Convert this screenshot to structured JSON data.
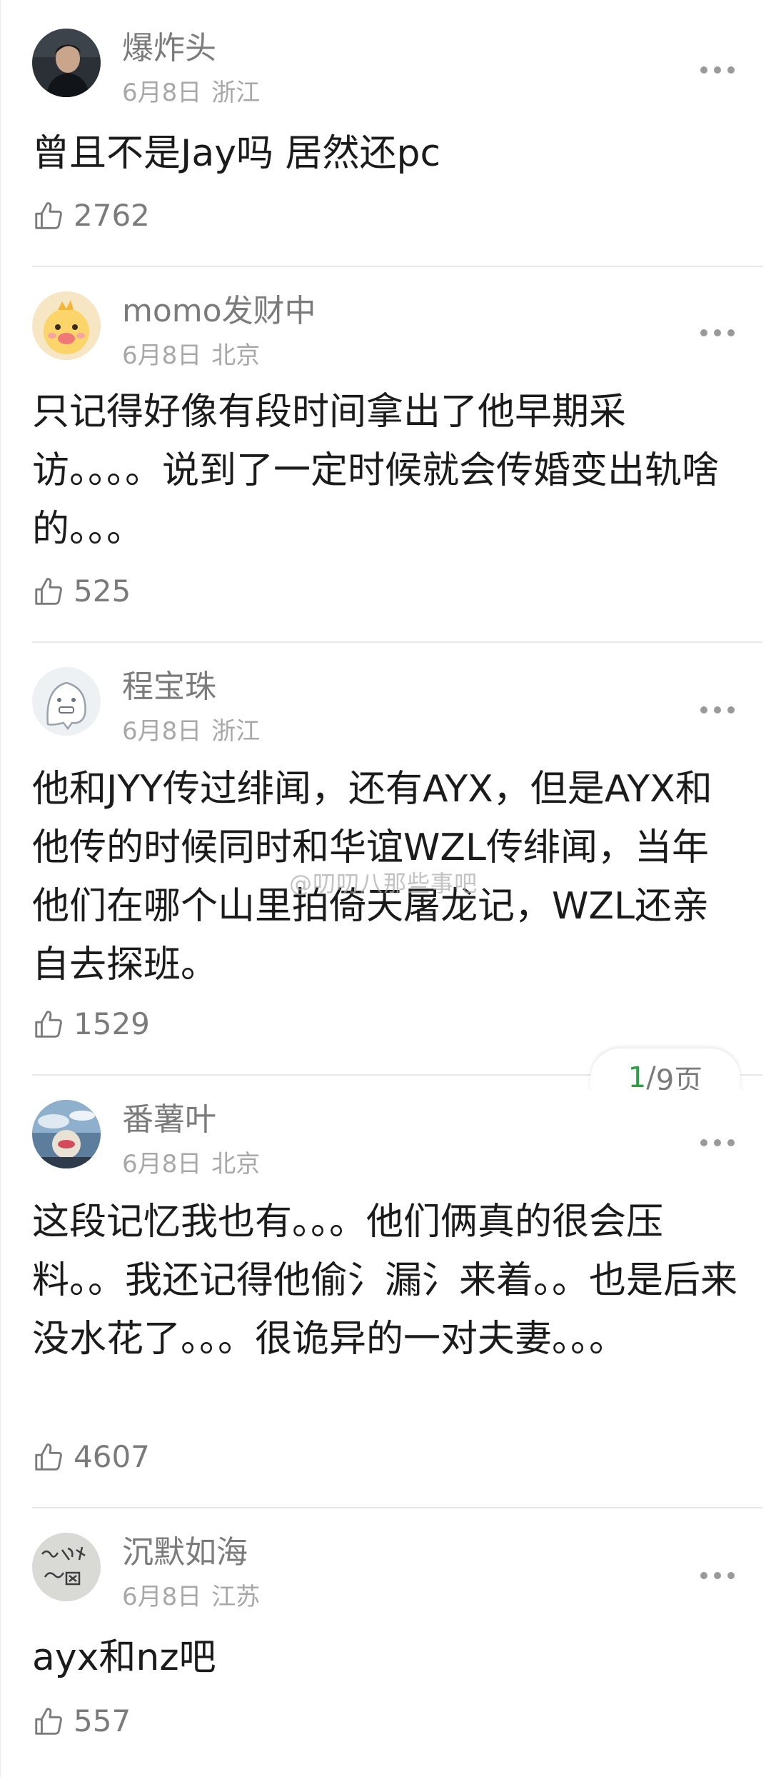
{
  "comments": [
    {
      "username": "爆炸头",
      "date": "6月8日",
      "location": "浙江",
      "text": "曾且不是Jay吗 居然还pc",
      "likes": "2762",
      "avatar_icon": "dark-portrait-avatar"
    },
    {
      "username": "momo发财中",
      "date": "6月8日",
      "location": "北京",
      "text": "只记得好像有段时间拿出了他早期采访。。。。说到了一定时候就会传婚变出轨啥的。。。",
      "likes": "525",
      "avatar_icon": "cartoon-chick-avatar"
    },
    {
      "username": "程宝珠",
      "date": "6月8日",
      "location": "浙江",
      "text": "他和JYY传过绯闻，还有AYX，但是AYX和他传的时候同时和华谊WZL传绯闻，当年他们在哪个山里拍倚天屠龙记，WZL还亲自去探班。",
      "likes": "1529",
      "avatar_icon": "cartoon-ghost-avatar"
    },
    {
      "username": "番薯叶",
      "date": "6月8日",
      "location": "北京",
      "text": "这段记忆我也有。。。他们俩真的很会压料。。我还记得他偷氵漏氵来着。。也是后来没水花了。。。很诡异的一对夫妻。。。",
      "likes": "4607",
      "avatar_icon": "sky-photo-avatar"
    },
    {
      "username": "沉默如海",
      "date": "6月8日",
      "location": "江苏",
      "text": "ayx和nz吧",
      "likes": "557",
      "avatar_icon": "handwriting-avatar"
    }
  ],
  "pager": {
    "current": "1",
    "separator": "/",
    "total_label": "9页"
  },
  "watermark": "@叨叨八那些事吧",
  "colors": {
    "accent_green": "#2f9e47",
    "meta_gray": "#a8a8a8",
    "name_gray": "#7b7b7b"
  }
}
